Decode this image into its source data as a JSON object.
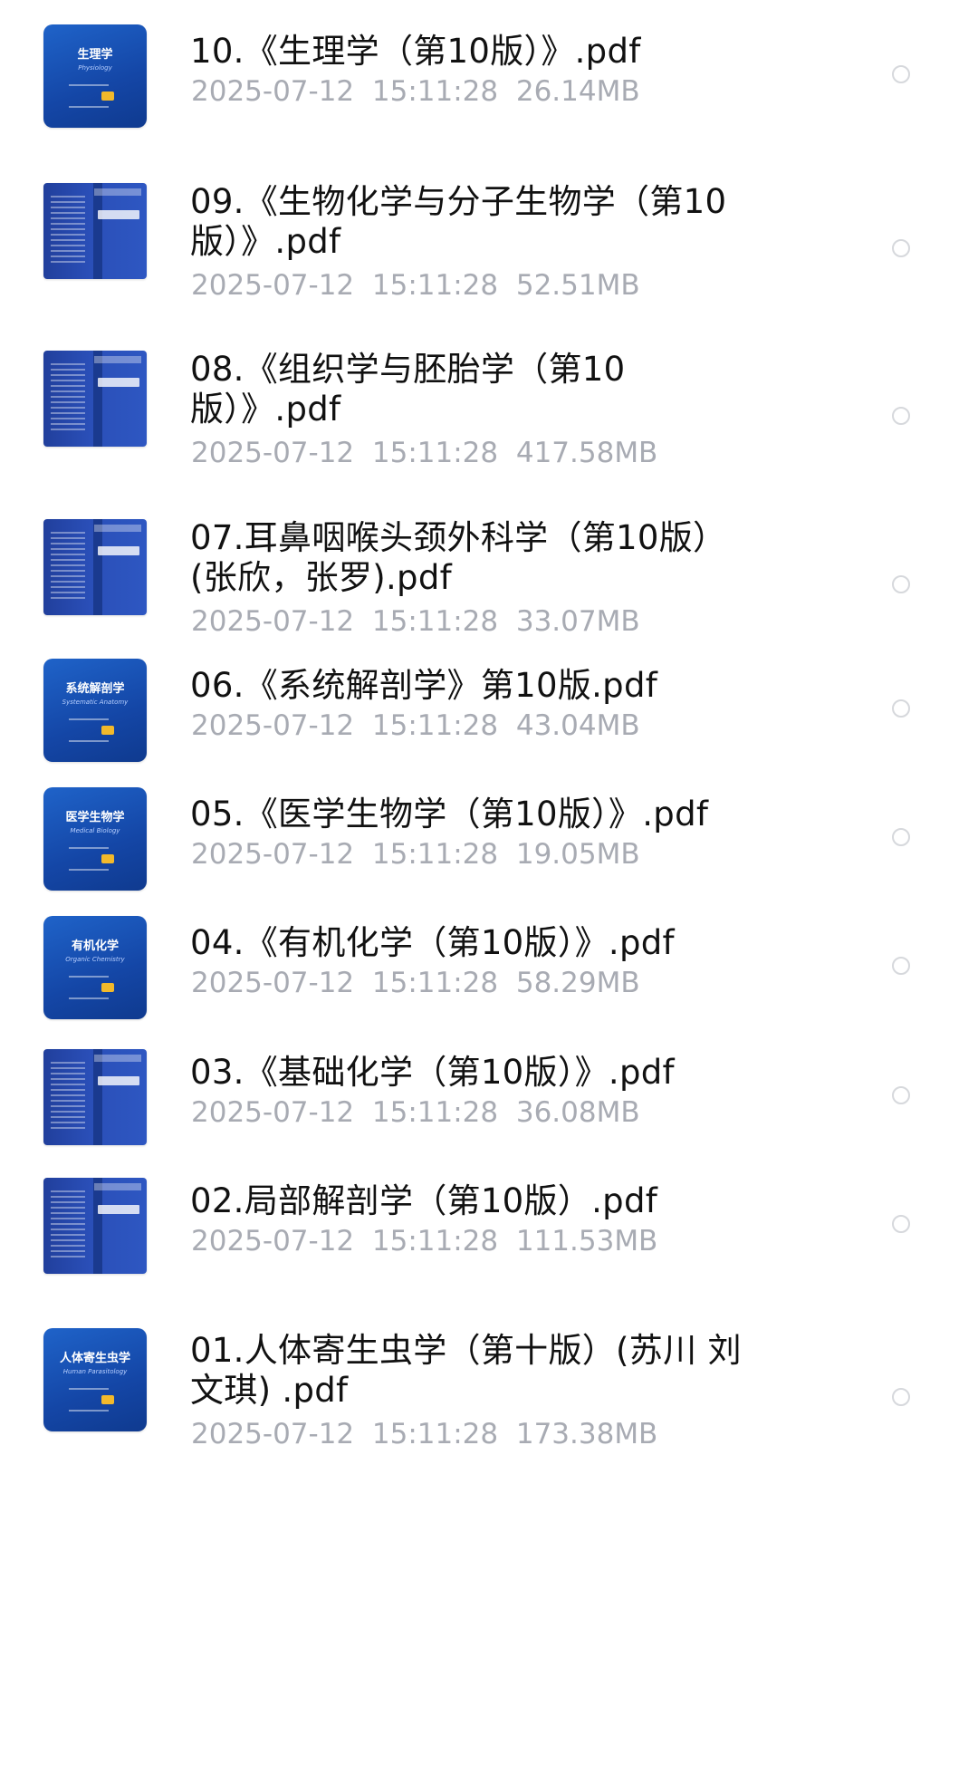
{
  "files": [
    {
      "name_lines": [
        "10.《生理学（第10版）》.pdf"
      ],
      "date": "2025-07-12",
      "time": "15:11:28",
      "size": "26.14MB",
      "thumbnail": {
        "kind": "front",
        "title": "生理学",
        "subtitle": "Physiology"
      }
    },
    {
      "name_lines": [
        "09.《生物化学与分子生物学（第10",
        "版）》.pdf"
      ],
      "date": "2025-07-12",
      "time": "15:11:28",
      "size": "52.51MB",
      "thumbnail": {
        "kind": "spread"
      }
    },
    {
      "name_lines": [
        "08.《组织学与胚胎学（第10",
        "版）》.pdf"
      ],
      "date": "2025-07-12",
      "time": "15:11:28",
      "size": "417.58MB",
      "thumbnail": {
        "kind": "spread"
      }
    },
    {
      "name_lines": [
        "07.耳鼻咽喉头颈外科学（第10版）",
        "(张欣，张罗).pdf"
      ],
      "date": "2025-07-12",
      "time": "15:11:28",
      "size": "33.07MB",
      "thumbnail": {
        "kind": "spread"
      }
    },
    {
      "name_lines": [
        "06.《系统解剖学》第10版.pdf"
      ],
      "date": "2025-07-12",
      "time": "15:11:28",
      "size": "43.04MB",
      "thumbnail": {
        "kind": "front",
        "title": "系统解剖学",
        "subtitle": "Systematic Anatomy"
      }
    },
    {
      "name_lines": [
        "05.《医学生物学（第10版）》.pdf"
      ],
      "date": "2025-07-12",
      "time": "15:11:28",
      "size": "19.05MB",
      "thumbnail": {
        "kind": "front",
        "title": "医学生物学",
        "subtitle": "Medical Biology"
      }
    },
    {
      "name_lines": [
        "04.《有机化学（第10版）》.pdf"
      ],
      "date": "2025-07-12",
      "time": "15:11:28",
      "size": "58.29MB",
      "thumbnail": {
        "kind": "front",
        "title": "有机化学",
        "subtitle": "Organic Chemistry"
      }
    },
    {
      "name_lines": [
        "03.《基础化学（第10版）》.pdf"
      ],
      "date": "2025-07-12",
      "time": "15:11:28",
      "size": "36.08MB",
      "thumbnail": {
        "kind": "spread"
      }
    },
    {
      "name_lines": [
        "02.局部解剖学（第10版）.pdf"
      ],
      "date": "2025-07-12",
      "time": "15:11:28",
      "size": "111.53MB",
      "thumbnail": {
        "kind": "spread"
      }
    },
    {
      "name_lines": [
        "01.人体寄生虫学（第十版）(苏川 刘",
        "文琪) .pdf"
      ],
      "date": "2025-07-12",
      "time": "15:11:28",
      "size": "173.38MB",
      "thumbnail": {
        "kind": "front",
        "title": "人体寄生虫学",
        "subtitle": "Human Parasitology"
      }
    }
  ],
  "colors": {
    "name_text": "#111111",
    "meta_text": "#a8abb3",
    "thumb_blue": "#1f63c9",
    "circle_border": "#d6d8dc"
  },
  "icons": {
    "select": "radio-circle-icon"
  }
}
